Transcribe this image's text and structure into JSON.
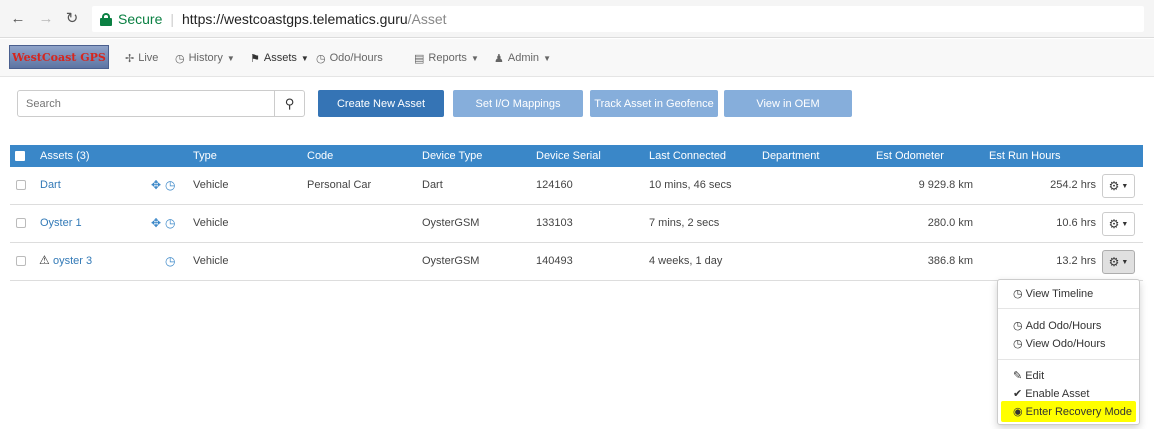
{
  "browser": {
    "secure_label": "Secure",
    "url_host": "https://westcoastgps.telematics.guru",
    "url_path": "/Asset"
  },
  "nav": {
    "logo_text": "WestCoast GPS",
    "items": [
      {
        "label": "Live",
        "icon": "crosshair-icon"
      },
      {
        "label": "History",
        "icon": "clock-icon"
      },
      {
        "label": "Assets",
        "icon": "flag-icon"
      },
      {
        "label": "Odo/Hours",
        "icon": "clock-icon"
      },
      {
        "label": "Reports",
        "icon": "report-icon"
      },
      {
        "label": "Admin",
        "icon": "user-icon"
      }
    ]
  },
  "toolbar": {
    "search_placeholder": "Search",
    "create_label": "Create New Asset",
    "io_label": "Set I/O Mappings",
    "track_label": "Track Asset in Geofence",
    "oem_label": "View in OEM"
  },
  "table": {
    "headers": [
      "Assets (3)",
      "Type",
      "Code",
      "Device Type",
      "Device Serial",
      "Last Connected",
      "Department",
      "Est Odometer",
      "Est Run Hours"
    ],
    "rows": [
      {
        "name": "Dart",
        "type": "Vehicle",
        "code": "Personal Car",
        "device_type": "Dart",
        "serial": "124160",
        "last_connected": "10 mins, 46 secs",
        "department": "",
        "odometer": "9 929.8 km",
        "run_hours": "254.2 hrs"
      },
      {
        "name": "Oyster 1",
        "type": "Vehicle",
        "code": "",
        "device_type": "OysterGSM",
        "serial": "133103",
        "last_connected": "7 mins, 2 secs",
        "department": "",
        "odometer": "280.0 km",
        "run_hours": "10.6 hrs"
      },
      {
        "name": "oyster 3",
        "type": "Vehicle",
        "code": "",
        "device_type": "OysterGSM",
        "serial": "140493",
        "last_connected": "4 weeks, 1 day",
        "department": "",
        "odometer": "386.8 km",
        "run_hours": "13.2 hrs"
      }
    ]
  },
  "dropdown": {
    "view_timeline": "View Timeline",
    "add_odo": "Add Odo/Hours",
    "view_odo": "View Odo/Hours",
    "edit": "Edit",
    "enable": "Enable Asset",
    "recovery": "Enter Recovery Mode"
  },
  "colors": {
    "header_blue": "#3a87c8",
    "primary_button": "#3574b5",
    "disabled_button": "#86aedb",
    "highlight": "#ffff00"
  }
}
